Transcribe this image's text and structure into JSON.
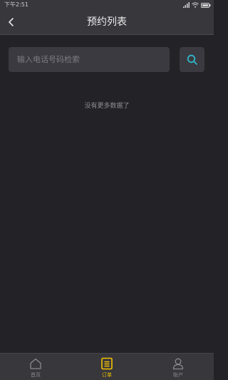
{
  "status_bar": {
    "time": "下午2:51"
  },
  "header": {
    "title": "预约列表"
  },
  "search": {
    "placeholder": "输入电话号码检索",
    "value": ""
  },
  "main": {
    "empty_text": "没有更多数据了"
  },
  "bottom_nav": {
    "items": [
      {
        "label": "首页",
        "icon": "home-icon"
      },
      {
        "label": "订单",
        "icon": "order-icon",
        "active": true
      },
      {
        "label": "账户",
        "icon": "user-icon"
      }
    ]
  },
  "colors": {
    "background": "#232227",
    "bar": "#38373c",
    "accent": "#f2c300",
    "search_icon": "#2fb8c9"
  }
}
